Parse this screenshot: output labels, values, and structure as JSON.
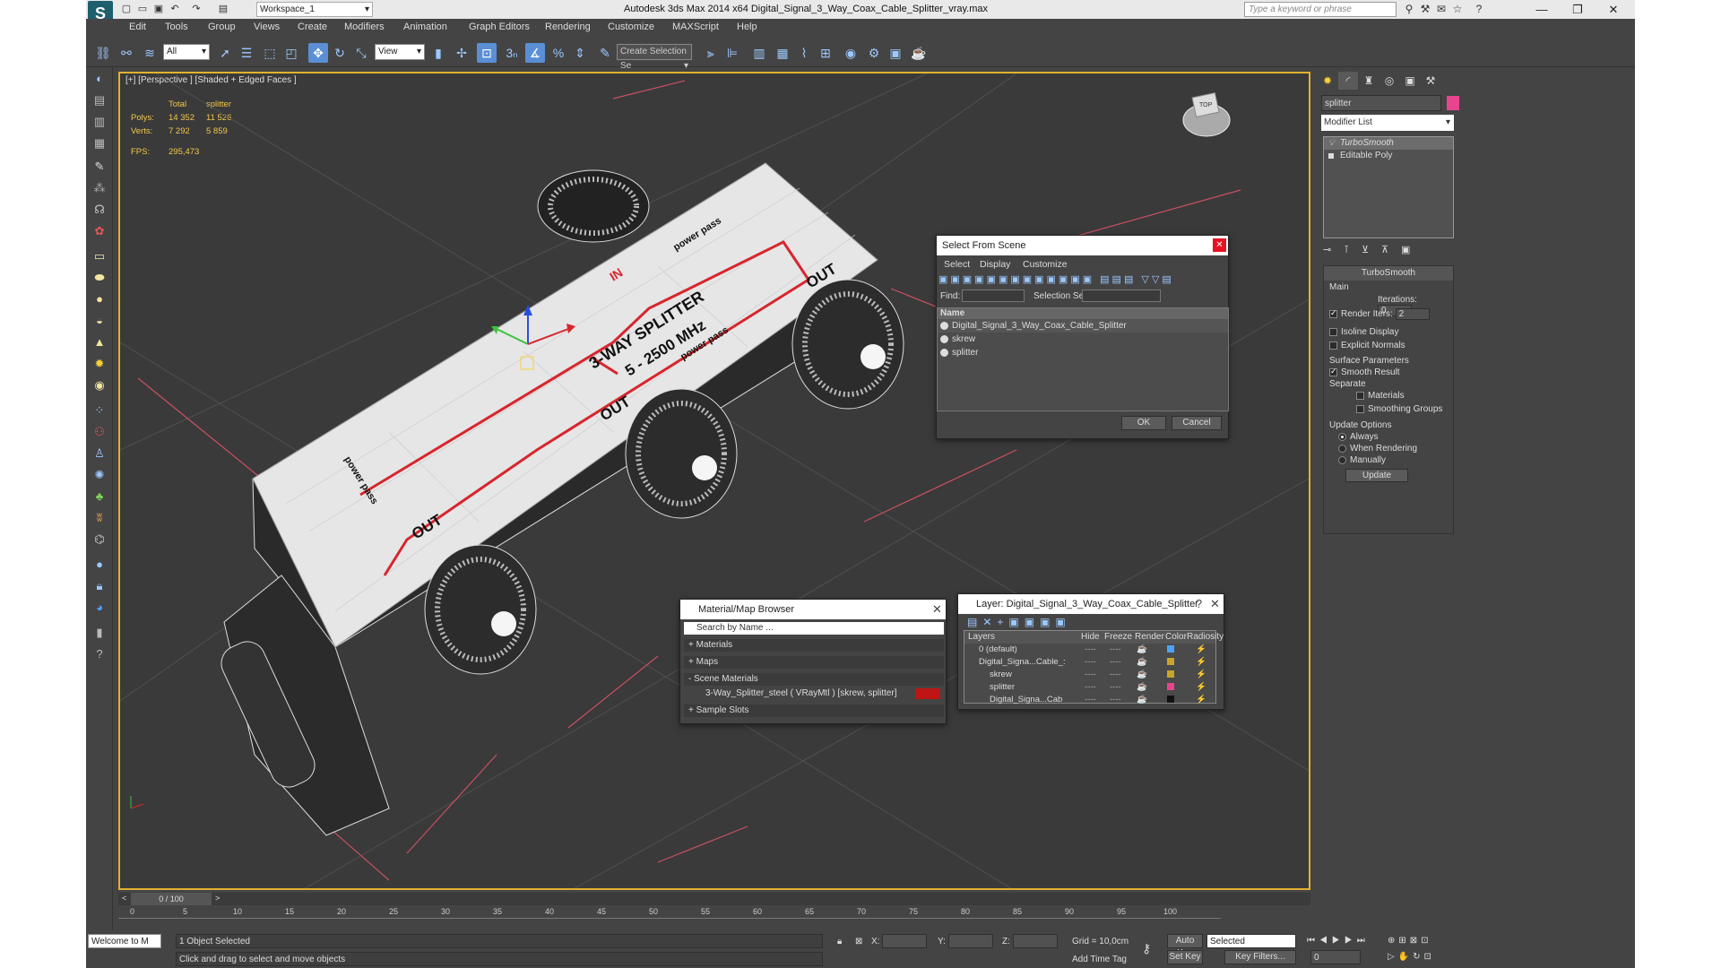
{
  "window": {
    "title": "Autodesk 3ds Max  2014 x64     Digital_Signal_3_Way_Coax_Cable_Splitter_vray.max",
    "workspace": "Workspace_1",
    "search_placeholder": "Type a keyword or phrase"
  },
  "menu": [
    "Edit",
    "Tools",
    "Group",
    "Views",
    "Create",
    "Modifiers",
    "Animation",
    "Graph Editors",
    "Rendering",
    "Customize",
    "MAXScript",
    "Help"
  ],
  "toolbar": {
    "selection_filter": "All",
    "ref_coord": "View",
    "named_selection": "Create Selection Se"
  },
  "viewport": {
    "label": "[+] [Perspective ] [Shaded + Edged Faces ]",
    "stats": {
      "col_total": "Total",
      "col_obj": "splitter",
      "polys_label": "Polys:",
      "polys_total": "14 352",
      "polys_obj": "11 526",
      "verts_label": "Verts:",
      "verts_total": "7 292",
      "verts_obj": "5 859",
      "fps_label": "FPS:",
      "fps": "295,473"
    },
    "model_text": {
      "title": "3-WAY SPLITTER",
      "freq": "5 - 2500 MHz",
      "in": "IN",
      "out1": "OUT",
      "out2": "OUT",
      "out3": "OUT",
      "pass1": "power pass",
      "pass2": "power pass",
      "pass3": "power pass"
    },
    "viewcube_label": "TOP"
  },
  "command_panel": {
    "object_name": "splitter",
    "object_color": "#e9448e",
    "modifier_list": "Modifier List",
    "stack": [
      "TurboSmooth",
      "Editable Poly"
    ],
    "rollout_title": "TurboSmooth",
    "main_label": "Main",
    "iterations_label": "Iterations:",
    "iterations": "0",
    "render_iters_label": "Render Iters:",
    "render_iters": "2",
    "isoline": "Isoline Display",
    "explicit_normals": "Explicit Normals",
    "surface_params": "Surface Parameters",
    "smooth_result": "Smooth Result",
    "separate": "Separate",
    "materials": "Materials",
    "smoothing_groups": "Smoothing Groups",
    "update_options": "Update Options",
    "always": "Always",
    "when_rendering": "When Rendering",
    "manually": "Manually",
    "update_btn": "Update"
  },
  "select_from_scene": {
    "title": "Select From Scene",
    "menu": [
      "Select",
      "Display",
      "Customize"
    ],
    "find_label": "Find:",
    "selset_label": "Selection Set:",
    "col_name": "Name",
    "items": [
      "Digital_Signal_3_Way_Coax_Cable_Splitter",
      "skrew",
      "splitter"
    ],
    "ok": "OK",
    "cancel": "Cancel"
  },
  "material_browser": {
    "title": "Material/Map Browser",
    "search_placeholder": "Search by Name ...",
    "materials": "+ Materials",
    "maps": "+ Maps",
    "scene_materials": "- Scene Materials",
    "scene_item": "3-Way_Splitter_steel  ( VRayMtl ) [skrew, splitter]",
    "sample_slots": "+ Sample Slots"
  },
  "layer_dialog": {
    "title": "Layer: Digital_Signal_3_Way_Coax_Cable_Splitter",
    "cols": [
      "Layers",
      "Hide",
      "Freeze",
      "Render",
      "Color",
      "Radiosity"
    ],
    "rows": [
      {
        "name": "0 (default)",
        "color": "#4aa3ff"
      },
      {
        "name": "Digital_Signa...Cable_:",
        "color": "#c8a52a"
      },
      {
        "name": "skrew",
        "color": "#c8a52a"
      },
      {
        "name": "splitter",
        "color": "#e9448e"
      },
      {
        "name": "Digital_Signa...Cab",
        "color": "#111111"
      }
    ]
  },
  "timeline": {
    "frame": "0 / 100",
    "ticks": [
      "0",
      "5",
      "10",
      "15",
      "20",
      "25",
      "30",
      "35",
      "40",
      "45",
      "50",
      "55",
      "60",
      "65",
      "70",
      "75",
      "80",
      "85",
      "90",
      "95",
      "100"
    ]
  },
  "status": {
    "maxscript": "Welcome to M",
    "selected": "1 Object Selected",
    "prompt": "Click and drag to select and move objects",
    "x_label": "X:",
    "y_label": "Y:",
    "z_label": "Z:",
    "grid": "Grid = 10,0cm",
    "add_time_tag": "Add Time Tag",
    "auto_key": "Auto Key",
    "set_key": "Set Key",
    "key_mode": "Selected",
    "key_filters": "Key Filters...",
    "frame_field": "0"
  }
}
